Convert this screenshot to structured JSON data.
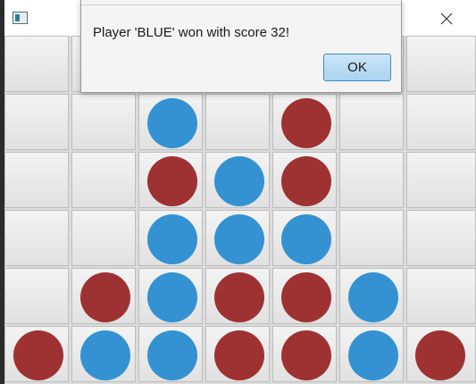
{
  "window": {
    "close_icon": "close-icon",
    "app_icon": "app-icon"
  },
  "colors": {
    "red": "#9e3232",
    "blue": "#3492d2"
  },
  "board": {
    "rows": [
      [
        "",
        "",
        "",
        "",
        "",
        "",
        ""
      ],
      [
        "",
        "",
        "blue",
        "",
        "red",
        "",
        ""
      ],
      [
        "",
        "",
        "red",
        "blue",
        "red",
        "",
        ""
      ],
      [
        "",
        "",
        "blue",
        "blue",
        "blue",
        "",
        ""
      ],
      [
        "",
        "red",
        "blue",
        "red",
        "red",
        "blue",
        ""
      ],
      [
        "red",
        "blue",
        "blue",
        "red",
        "red",
        "blue",
        "red"
      ]
    ]
  },
  "dialog": {
    "message": "Player 'BLUE' won with score 32!",
    "ok_label": "OK"
  }
}
